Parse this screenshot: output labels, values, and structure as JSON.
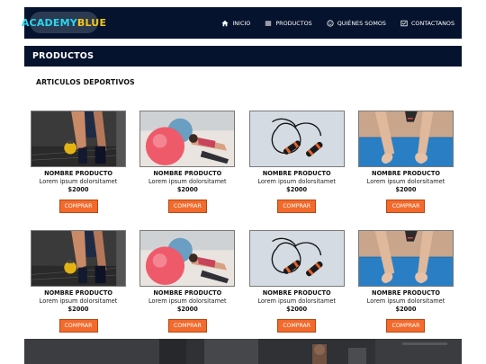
{
  "brand": {
    "part1": "ACADEMY",
    "part2": "BLUE"
  },
  "nav": [
    {
      "label": "INICIO",
      "icon": "home-icon"
    },
    {
      "label": "PRODUCTOS",
      "icon": "list-icon"
    },
    {
      "label": "QUIÉNES SOMOS",
      "icon": "smiley-icon"
    },
    {
      "label": "CONTACTANOS",
      "icon": "mail-icon"
    }
  ],
  "section_title": "PRODUCTOS",
  "subtitle": "ARTICULOS DEPORTIVOS",
  "rows": [
    [
      {
        "image": "kettlebell-athlete-photo",
        "name": "NOMBRE PRODUCTO",
        "desc": "Lorem ipsum dolorsitamet",
        "price": "$2000",
        "button": "COMPRAR"
      },
      {
        "image": "exercise-ball-photo",
        "name": "NOMBRE PRODUCTO",
        "desc": "Lorem ipsum dolorsitamet",
        "price": "$2000",
        "button": "COMPRAR"
      },
      {
        "image": "jump-rope-photo",
        "name": "NOMBRE PRODUCTO",
        "desc": "Lorem ipsum dolorsitamet",
        "price": "$2000",
        "button": "COMPRAR"
      },
      {
        "image": "yoga-mat-photo",
        "name": "NOMBRE PRODUCTO",
        "desc": "Lorem ipsum dolorsitamet",
        "price": "$2000",
        "button": "COMPRAR"
      }
    ],
    [
      {
        "image": "kettlebell-athlete-photo",
        "name": "NOMBRE PRODUCTO",
        "desc": "Lorem ipsum dolorsitamet",
        "price": "$2000",
        "button": "COMPRAR"
      },
      {
        "image": "exercise-ball-photo",
        "name": "NOMBRE PRODUCTO",
        "desc": "Lorem ipsum dolorsitamet",
        "price": "$2000",
        "button": "COMPRAR"
      },
      {
        "image": "jump-rope-photo",
        "name": "NOMBRE PRODUCTO",
        "desc": "Lorem ipsum dolorsitamet",
        "price": "$2000",
        "button": "COMPRAR"
      },
      {
        "image": "yoga-mat-photo",
        "name": "NOMBRE PRODUCTO",
        "desc": "Lorem ipsum dolorsitamet",
        "price": "$2000",
        "button": "COMPRAR"
      }
    ]
  ],
  "colors": {
    "navy": "#06132e",
    "button": "#f26a2c",
    "logo_primary": "#2ad6f0",
    "logo_accent": "#f5c518"
  }
}
